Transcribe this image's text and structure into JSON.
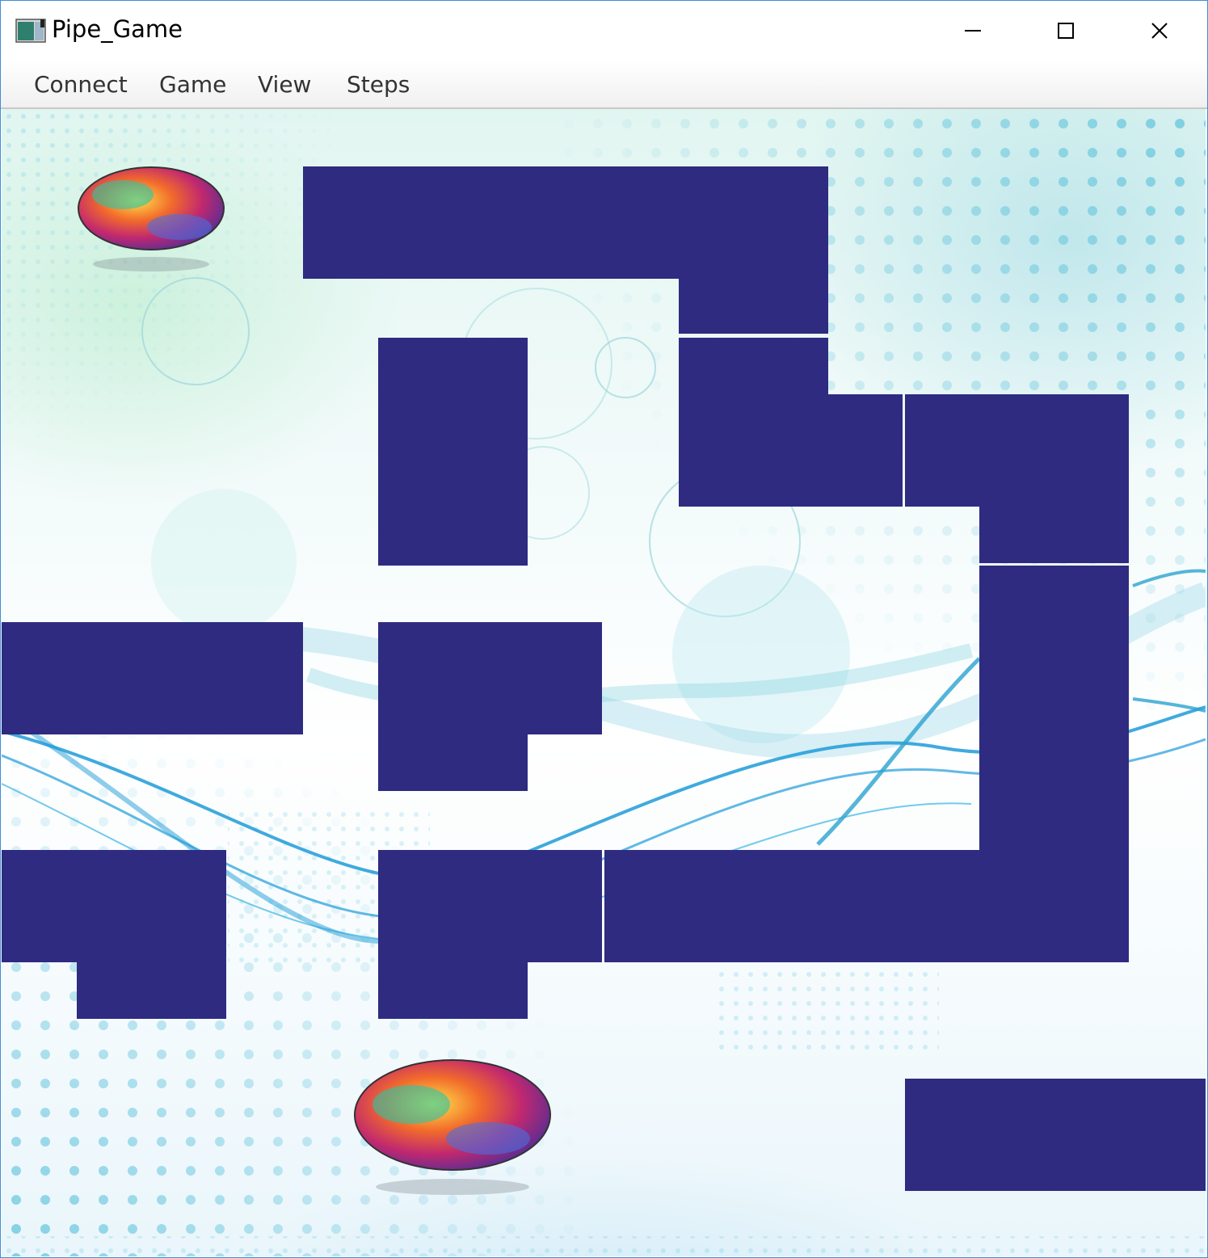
{
  "window": {
    "title": "Pipe_Game",
    "controls": {
      "minimize": "minimize",
      "maximize": "maximize",
      "close": "close"
    }
  },
  "menu": {
    "items": [
      "Connect",
      "Game",
      "View",
      "Steps"
    ]
  },
  "colors": {
    "pipe": "#2e2b80",
    "window_border": "#3c8ed8",
    "background_dots": "#5ec3dc",
    "background_wave": "#1e9bd8"
  },
  "board": {
    "start_marker_icon": "rainbow-ball-icon",
    "goal_marker_icon": "rainbow-ball-icon"
  }
}
